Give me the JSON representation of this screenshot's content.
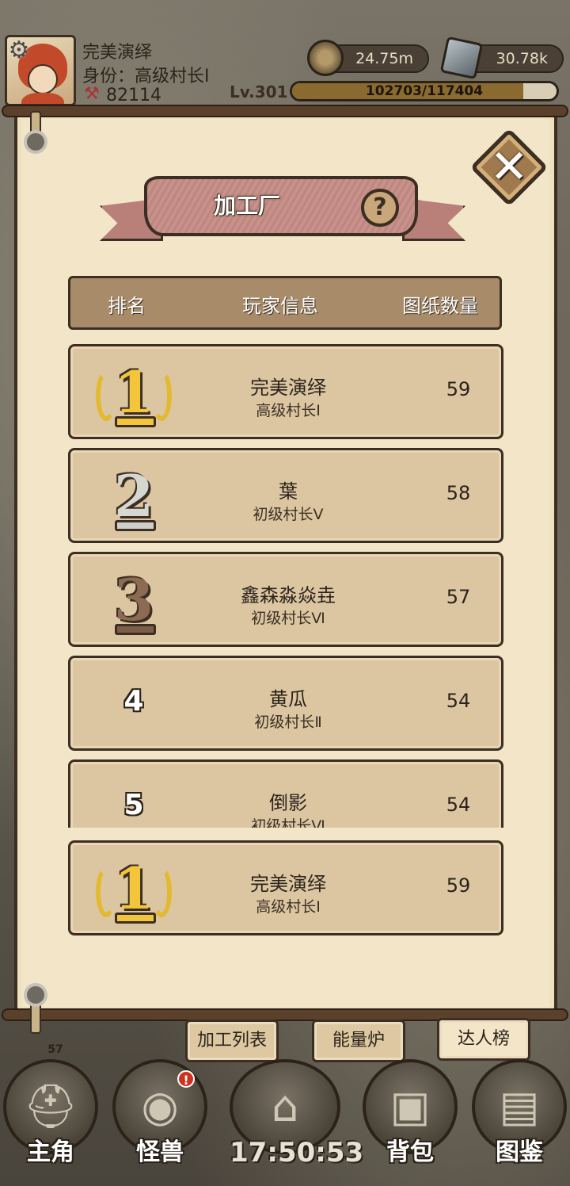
{
  "player": {
    "name": "完美演绎",
    "rank_title": "身份：高级村长Ⅰ",
    "power": "82114",
    "level": "Lv.301",
    "xp_text": "102703/117404",
    "xp_fraction": 0.875
  },
  "resources": {
    "coins": "24.75m",
    "ore": "30.78k"
  },
  "panel": {
    "title": "加工厂",
    "columns": {
      "rank": "排名",
      "info": "玩家信息",
      "count": "图纸数量"
    },
    "rows": [
      {
        "rank": "1",
        "name": "完美演绎",
        "title": "高级村长Ⅰ",
        "count": "59"
      },
      {
        "rank": "2",
        "name": "葉",
        "title": "初级村长Ⅴ",
        "count": "58"
      },
      {
        "rank": "3",
        "name": "鑫森淼焱垚",
        "title": "初级村长Ⅵ",
        "count": "57"
      },
      {
        "rank": "4",
        "name": "黄瓜",
        "title": "初级村长Ⅱ",
        "count": "54"
      },
      {
        "rank": "5",
        "name": "倒影",
        "title": "初级村长Ⅵ",
        "count": "54"
      }
    ],
    "self_row": {
      "rank": "1",
      "name": "完美演绎",
      "title": "高级村长Ⅰ",
      "count": "59"
    }
  },
  "tabs": {
    "list": "加工列表",
    "energy": "能量炉",
    "leaderboard": "达人榜"
  },
  "nav": {
    "hero": "主角",
    "monster": "怪兽",
    "bag": "背包",
    "atlas": "图鉴",
    "hero_level": "57",
    "monster_badge": "!",
    "clock": "17:50:53"
  },
  "colors": {
    "parchment": "#f3e6c8",
    "row_bg": "#dcc6a2",
    "header_bg": "#a88c6a",
    "gold": "#f2c53a",
    "silver": "#d7d7d2",
    "bronze": "#8d6b52",
    "banner": "#c8918a"
  },
  "icons": {
    "settings": "gear-icon",
    "coins": "coin-icon",
    "ore": "ore-icon",
    "close": "close-icon",
    "help": "help-icon"
  }
}
